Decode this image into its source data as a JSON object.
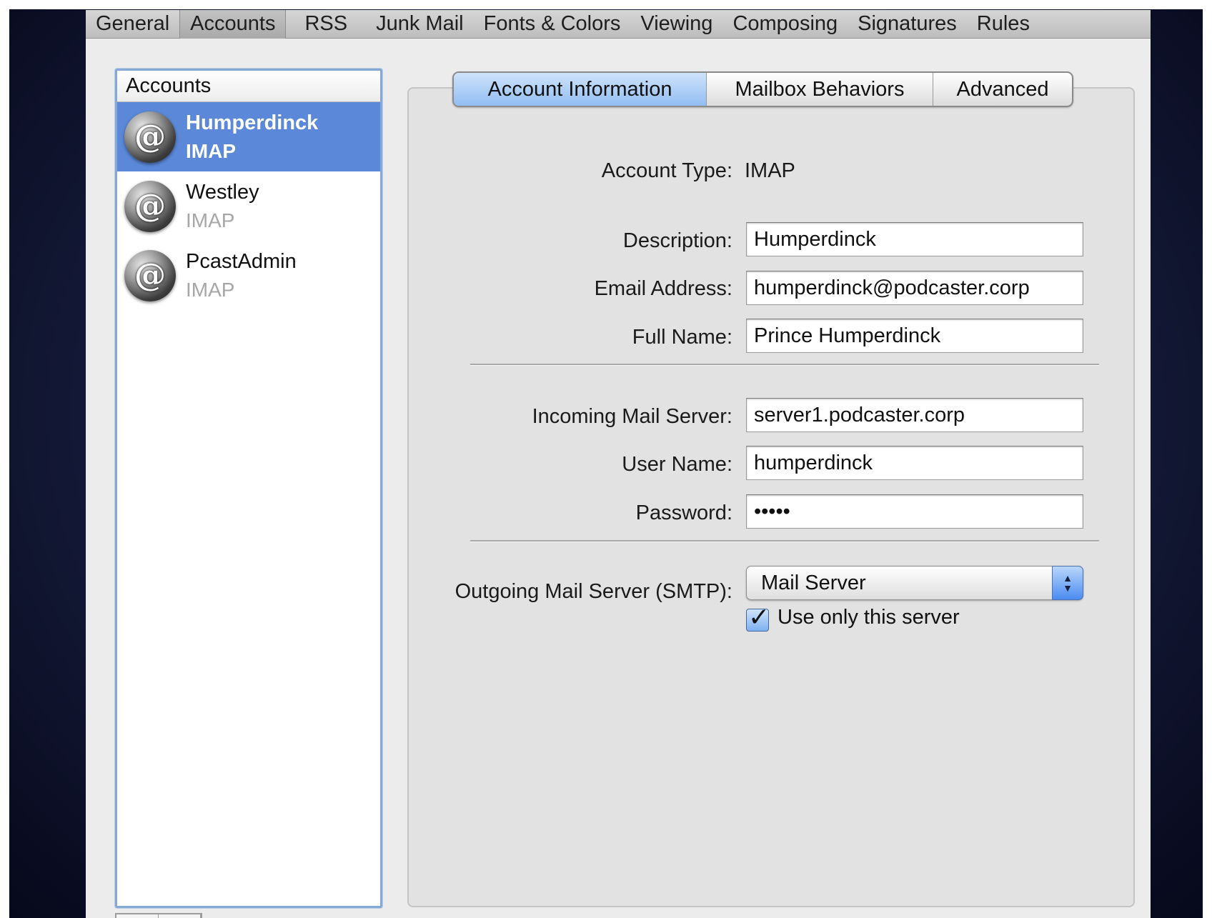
{
  "toolbar": {
    "items": [
      "General",
      "Accounts",
      "RSS",
      "Junk Mail",
      "Fonts & Colors",
      "Viewing",
      "Composing",
      "Signatures",
      "Rules"
    ]
  },
  "accounts": {
    "header": "Accounts",
    "items": [
      {
        "name": "Humperdinck",
        "type": "IMAP",
        "icon": "@"
      },
      {
        "name": "Westley",
        "type": "IMAP",
        "icon": "@"
      },
      {
        "name": "PcastAdmin",
        "type": "IMAP",
        "icon": "@"
      }
    ]
  },
  "tabs": {
    "items": [
      "Account Information",
      "Mailbox Behaviors",
      "Advanced"
    ]
  },
  "form": {
    "account_type_label": "Account Type:",
    "account_type_value": "IMAP",
    "description_label": "Description:",
    "description_value": "Humperdinck",
    "email_label": "Email Address:",
    "email_value": "humperdinck@podcaster.corp",
    "full_name_label": "Full Name:",
    "full_name_value": "Prince Humperdinck",
    "incoming_label": "Incoming Mail Server:",
    "incoming_value": "server1.podcaster.corp",
    "username_label": "User Name:",
    "username_value": "humperdinck",
    "password_label": "Password:",
    "password_value": "•••••",
    "smtp_label": "Outgoing Mail Server (SMTP):",
    "smtp_value": "Mail Server",
    "use_only_label": "Use only this server",
    "use_only_checked": true
  }
}
